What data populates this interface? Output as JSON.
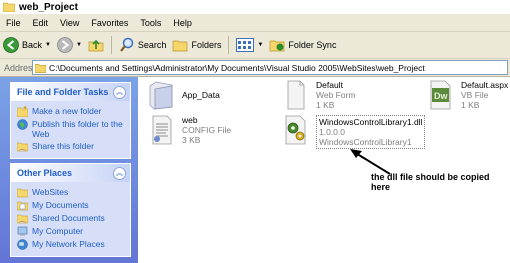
{
  "window": {
    "title": "web_Project"
  },
  "menu": [
    "File",
    "Edit",
    "View",
    "Favorites",
    "Tools",
    "Help"
  ],
  "toolbar": {
    "back_label": "Back",
    "search_label": "Search",
    "folders_label": "Folders",
    "folder_sync_label": "Folder Sync"
  },
  "address": {
    "label": "Address",
    "path": "C:\\Documents and Settings\\Administrator\\My Documents\\Visual Studio 2005\\WebSites\\web_Project"
  },
  "tasks": {
    "title": "File and Folder Tasks",
    "items": [
      {
        "label": "Make a new folder",
        "icon": "new-folder-icon"
      },
      {
        "label": "Publish this folder to the Web",
        "icon": "publish-web-icon"
      },
      {
        "label": "Share this folder",
        "icon": "share-folder-icon"
      }
    ]
  },
  "places": {
    "title": "Other Places",
    "items": [
      {
        "label": "WebSites",
        "icon": "folder-icon"
      },
      {
        "label": "My Documents",
        "icon": "my-documents-icon"
      },
      {
        "label": "Shared Documents",
        "icon": "shared-documents-icon"
      },
      {
        "label": "My Computer",
        "icon": "my-computer-icon"
      },
      {
        "label": "My Network Places",
        "icon": "network-places-icon"
      }
    ]
  },
  "files": [
    {
      "name": "App_Data",
      "type": "",
      "size": "",
      "icon": "folder-icon"
    },
    {
      "name": "Default",
      "type": "Web Form",
      "size": "1 KB",
      "icon": "web-form-icon"
    },
    {
      "name": "Default.aspx",
      "type": "VB File",
      "size": "1 KB",
      "icon": "dreamweaver-file-icon"
    },
    {
      "name": "web",
      "type": "CONFIG File",
      "size": "3 KB",
      "icon": "config-file-icon"
    },
    {
      "name": "WindowsControlLibrary1.dll",
      "type": "1.0.0.0",
      "size": "WindowsControlLibrary1",
      "icon": "dll-file-icon"
    }
  ],
  "annotation": "the dll file should be copied here",
  "colors": {
    "task_pane_top": "#7ba2e7",
    "task_pane_bottom": "#6375d6",
    "link": "#215dc6",
    "chrome": "#ece9d8"
  }
}
